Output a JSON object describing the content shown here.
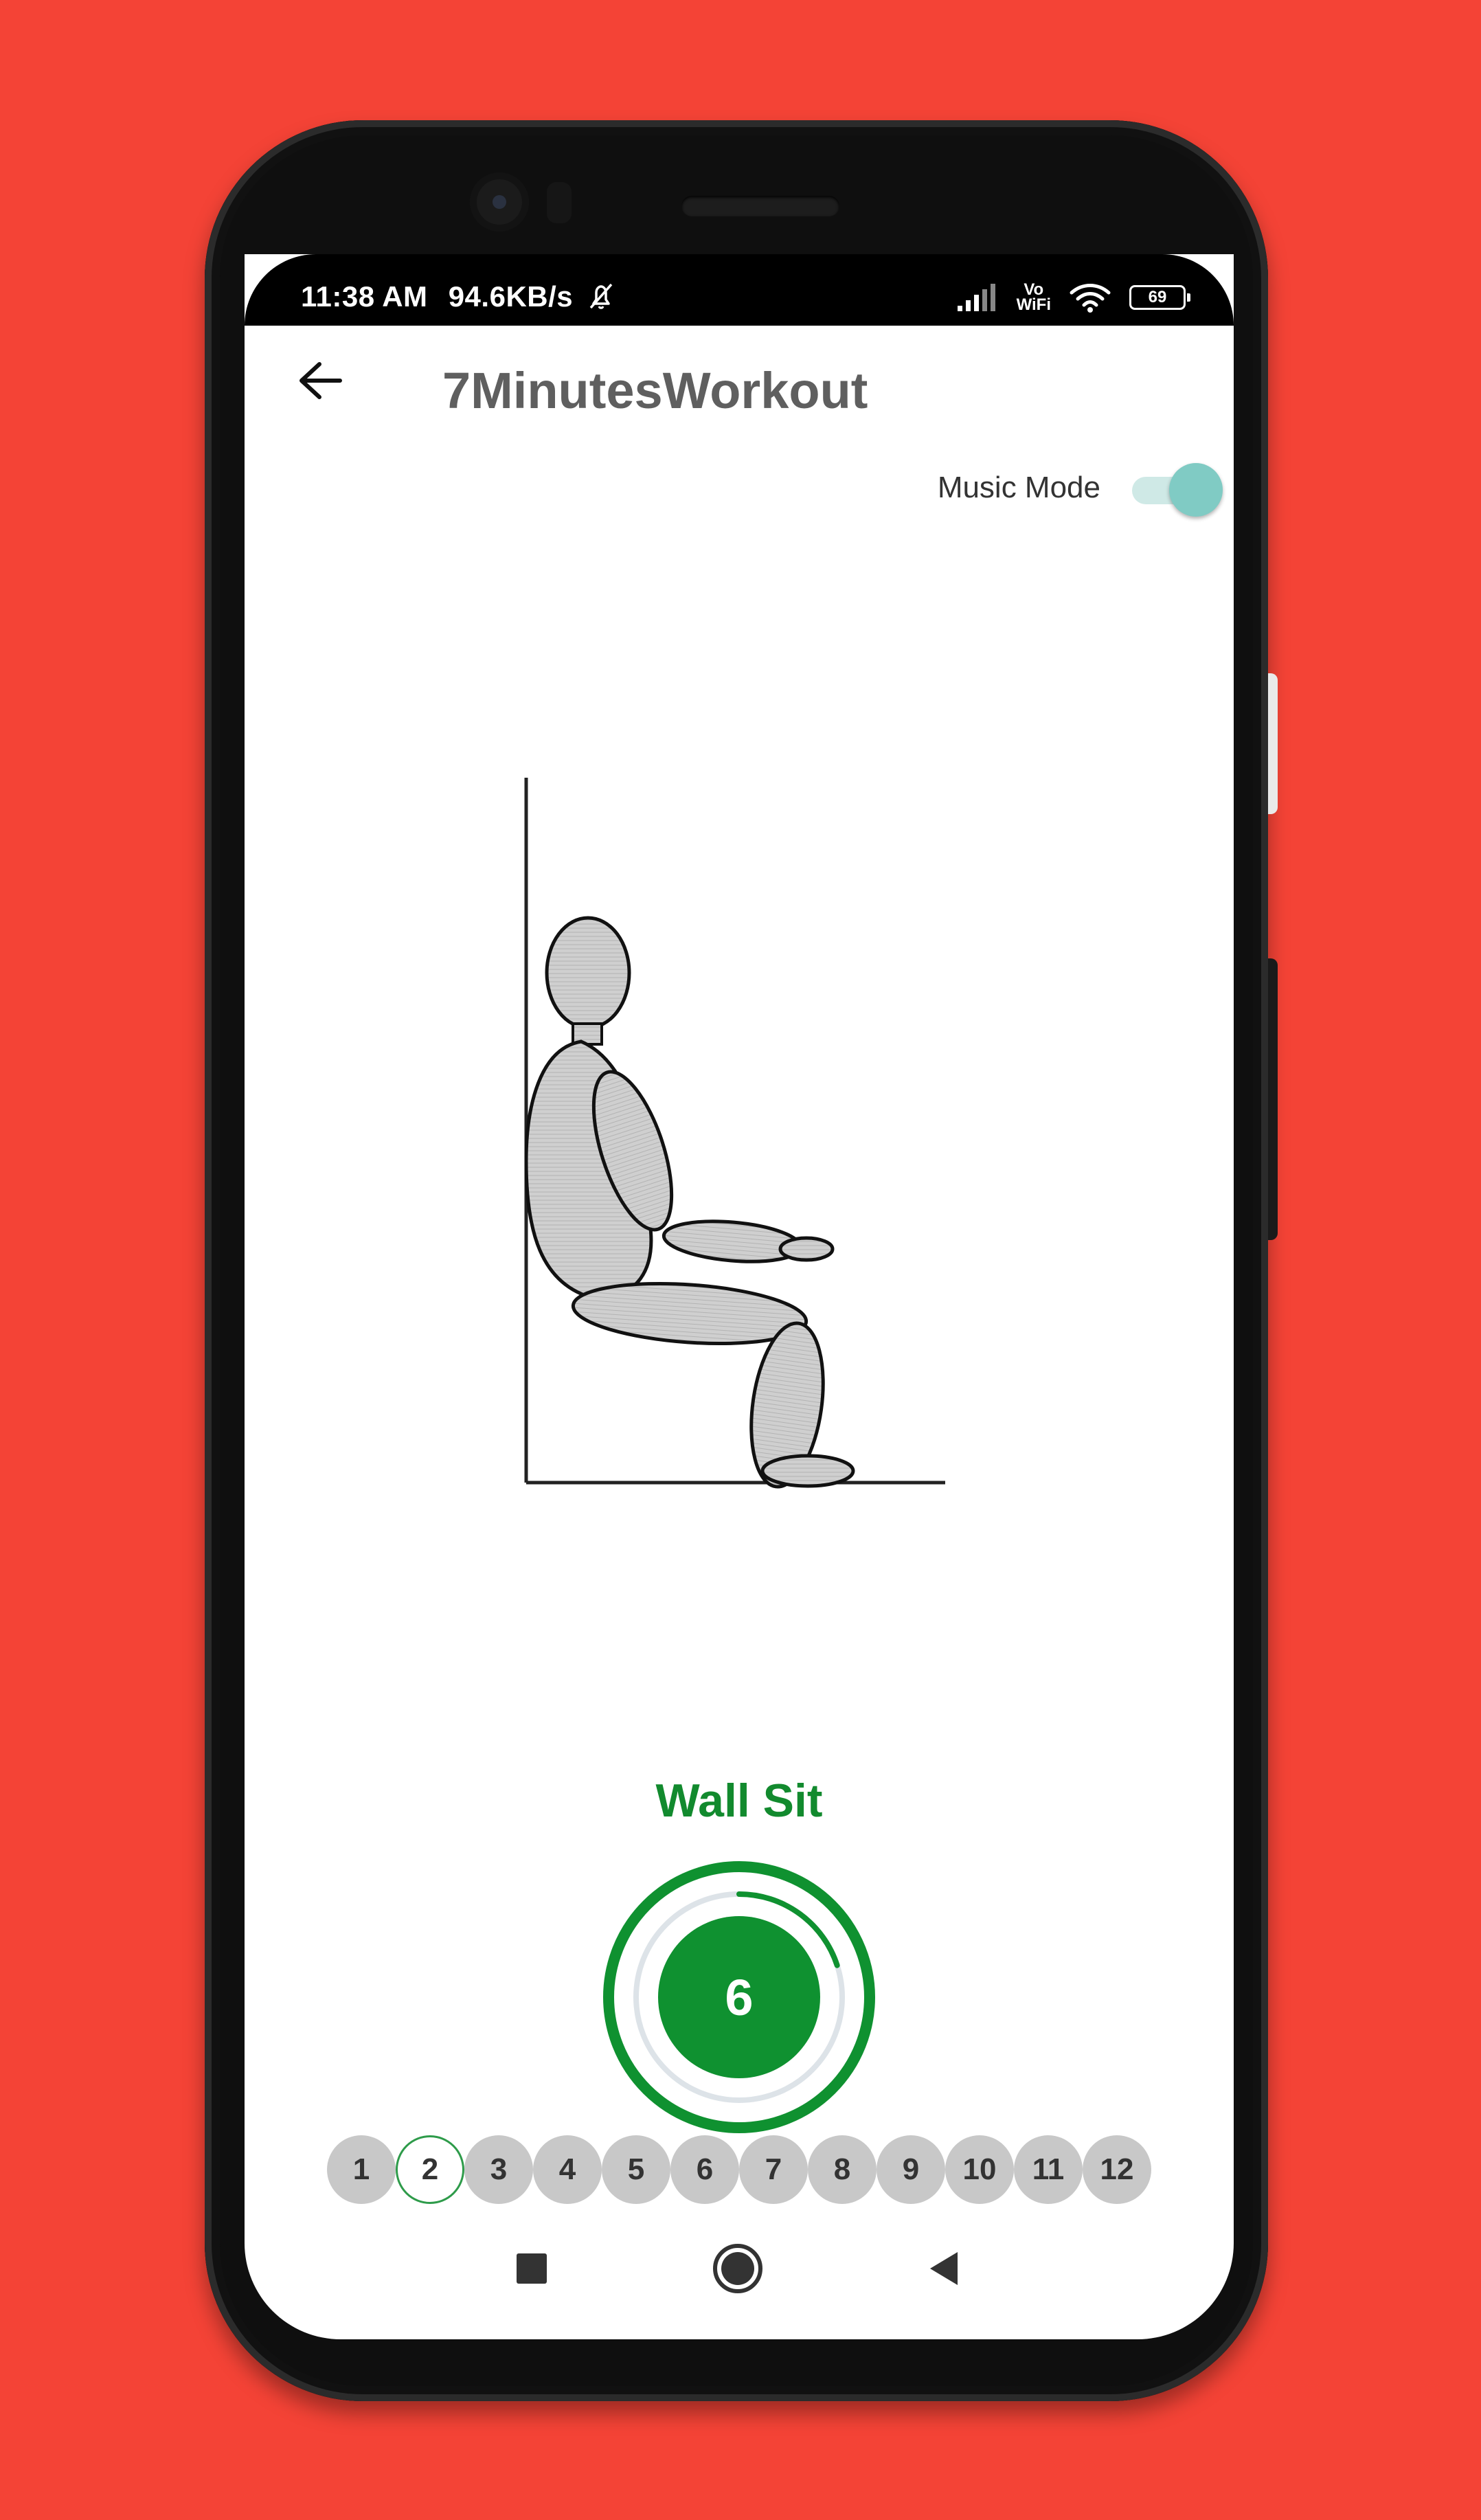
{
  "status_bar": {
    "time": "11:38 AM",
    "net_speed": "94.6KB/s",
    "network_label_top": "Vo",
    "network_label_bottom": "WiFi",
    "battery": "69"
  },
  "app_bar": {
    "title": "7MinutesWorkout",
    "back_icon": "arrow-left-icon"
  },
  "music_mode": {
    "label": "Music Mode",
    "enabled": true,
    "accent": "#80cbc4"
  },
  "exercise": {
    "name": "Wall Sit",
    "timer_value": "6",
    "progress_fraction": 0.2,
    "color": "#0f9130"
  },
  "steps": {
    "items": [
      "1",
      "2",
      "3",
      "4",
      "5",
      "6",
      "7",
      "8",
      "9",
      "10",
      "11",
      "12"
    ],
    "current": "2"
  },
  "nav": {
    "recents_icon": "square-icon",
    "home_icon": "circle-icon",
    "back_icon": "triangle-back-icon"
  },
  "colors": {
    "background": "#f44336",
    "title_gray": "#5f5f5f",
    "exercise_green": "#128a2e"
  }
}
